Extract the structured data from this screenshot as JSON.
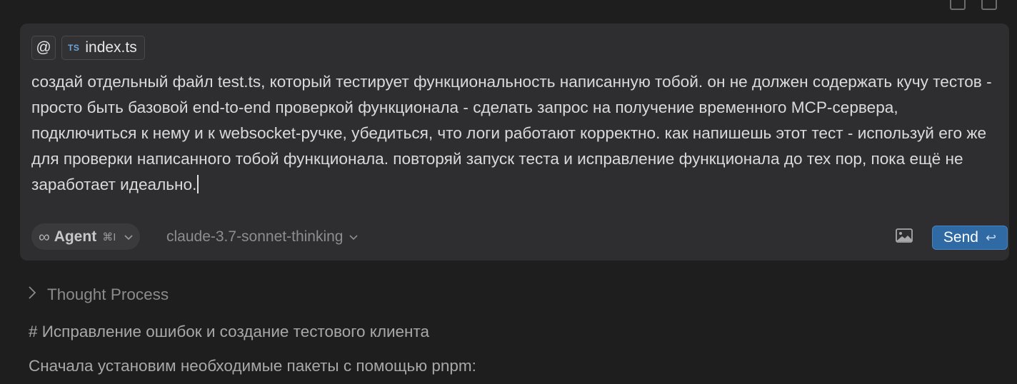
{
  "composer": {
    "at_symbol": "@",
    "file_chip": {
      "badge": "TS",
      "name": "index.ts"
    },
    "prompt": "создай отдельный файл test.ts, который тестирует функциональность написанную тобой. он не должен содержать кучу тестов - просто быть базовой end-to-end проверкой функционала - сделать запрос на получение временного MCP-сервера, подключиться к нему и к websocket-ручке, убедиться, что логи работают корректно. как напишешь этот тест - используй его же для проверки написанного тобой функционала. повторяй запуск теста и исправление функционала до тех пор, пока ещё не заработает идеально.",
    "mode": {
      "icon": "∞",
      "label": "Agent",
      "shortcut": "⌘I"
    },
    "model": "claude-3.7-sonnet-thinking",
    "send_label": "Send",
    "send_icon": "↩"
  },
  "response": {
    "thought_label": "Thought Process",
    "heading": "# Исправление ошибок и создание тестового клиента",
    "paragraph": "Сначала установим необходимые пакеты с помощью pnpm:"
  },
  "colors": {
    "background": "#1e1e1f",
    "composer_bg": "#2e2e30",
    "send_bg": "#2f6aa5",
    "ts_badge": "#6aa6da"
  }
}
